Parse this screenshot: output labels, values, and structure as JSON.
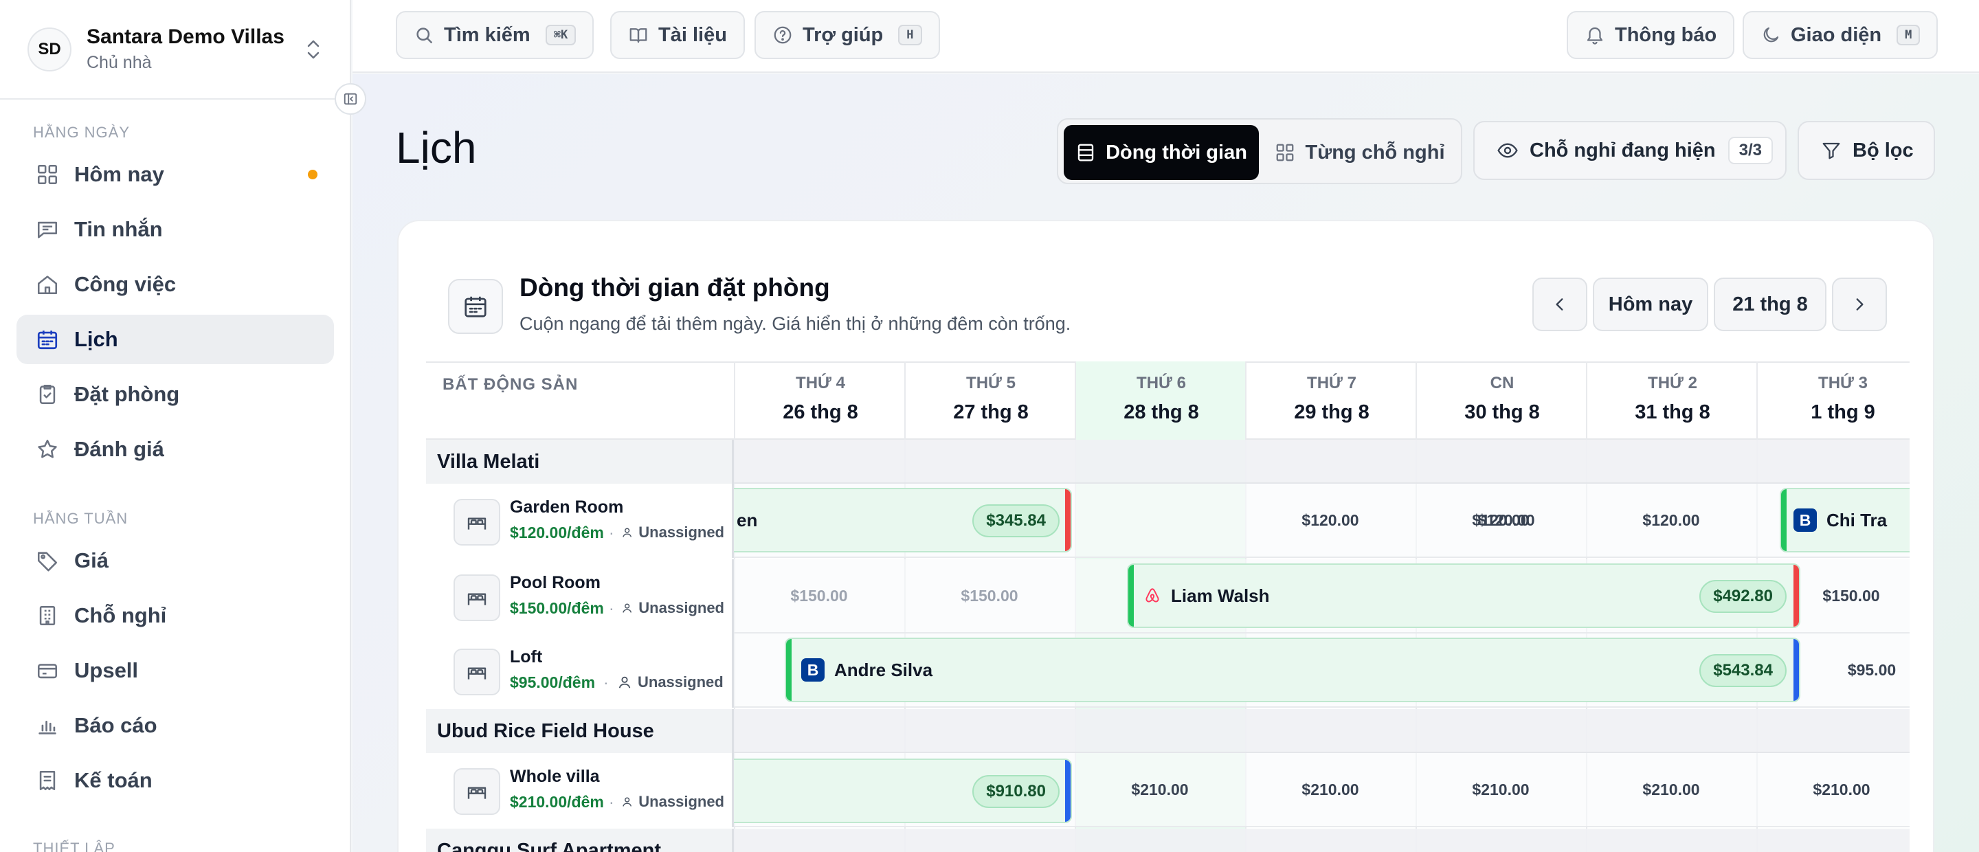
{
  "org": {
    "initials": "SD",
    "name": "Santara Demo Villas",
    "role": "Chủ nhà"
  },
  "sections": {
    "daily": "HẰNG NGÀY",
    "weekly": "HẰNG TUẦN",
    "setup": "THIẾT LẬP"
  },
  "nav": [
    {
      "label": "Hôm nay"
    },
    {
      "label": "Tin nhắn"
    },
    {
      "label": "Công việc"
    },
    {
      "label": "Lịch"
    },
    {
      "label": "Đặt phòng"
    },
    {
      "label": "Đánh giá"
    },
    {
      "label": "Giá"
    },
    {
      "label": "Chỗ nghỉ"
    },
    {
      "label": "Upsell"
    },
    {
      "label": "Báo cáo"
    },
    {
      "label": "Kế toán"
    }
  ],
  "topbar": {
    "search": "Tìm kiếm",
    "search_kbd": "⌘K",
    "docs": "Tài liệu",
    "help": "Trợ giúp",
    "help_kbd": "H",
    "notifications": "Thông báo",
    "theme": "Giao diện",
    "theme_kbd": "M"
  },
  "page": {
    "title": "Lịch",
    "view_timeline": "Dòng thời gian",
    "view_property": "Từng chỗ nghỉ",
    "visible_label": "Chỗ nghỉ đang hiện",
    "visible_count": "3/3",
    "filter": "Bộ lọc"
  },
  "card": {
    "title": "Dòng thời gian đặt phòng",
    "subtitle": "Cuộn ngang để tải thêm ngày. Giá hiển thị ở những đêm còn trống.",
    "today": "Hôm nay",
    "date": "21 thg 8",
    "property_header": "BẤT ĐỘNG SẢN"
  },
  "days": [
    {
      "name": "THỨ 4",
      "date": "26 thg 8"
    },
    {
      "name": "THỨ 5",
      "date": "27 thg 8"
    },
    {
      "name": "THỨ 6",
      "date": "28 thg 8"
    },
    {
      "name": "THỨ 7",
      "date": "29 thg 8"
    },
    {
      "name": "CN",
      "date": "30 thg 8"
    },
    {
      "name": "THỨ 2",
      "date": "31 thg 8"
    },
    {
      "name": "THỨ 3",
      "date": "1 thg 9"
    }
  ],
  "groups": [
    {
      "name": "Villa Melati"
    },
    {
      "name": "Ubud Rice Field House"
    },
    {
      "name": "Canggu Surf Apartment"
    }
  ],
  "units": [
    {
      "name": "Garden Room",
      "price": "$120.00/đêm",
      "assign": "Unassigned"
    },
    {
      "name": "Pool Room",
      "price": "$150.00/đêm",
      "assign": "Unassigned"
    },
    {
      "name": "Loft",
      "price": "$95.00/đêm",
      "assign": "Unassigned"
    },
    {
      "name": "Whole villa",
      "price": "$210.00/đêm",
      "assign": "Unassigned"
    }
  ],
  "prices": {
    "garden": [
      "$120.00",
      "$120.00",
      "$120.00",
      "$120.00"
    ],
    "pool_pre": [
      "$150.00",
      "$150.00"
    ],
    "pool_post": "$150.00",
    "loft_post": "$95.00",
    "villa": [
      "$210.00",
      "$210.00",
      "$210.00",
      "$210.00",
      "$210.00"
    ]
  },
  "bookings": [
    {
      "guest": "en",
      "amount": "$345.84",
      "source": "",
      "end_color": "#ef4444"
    },
    {
      "guest": "Chi Tra",
      "amount": "",
      "source": "Booking.com",
      "end_color": ""
    },
    {
      "guest": "Liam Walsh",
      "amount": "$492.80",
      "source": "Airbnb",
      "end_color": "#ef4444"
    },
    {
      "guest": "Andre Silva",
      "amount": "$543.84",
      "source": "Booking.com",
      "end_color": "#2563eb"
    },
    {
      "guest": "",
      "amount": "$910.80",
      "source": "",
      "end_color": "#2563eb"
    }
  ],
  "booking_source_badge": "B",
  "colors": {
    "accent": "#05070c",
    "green": "#15803d",
    "today_col": "#eafaf1",
    "airbnb": "#ff385c",
    "booking": "#003b95"
  }
}
